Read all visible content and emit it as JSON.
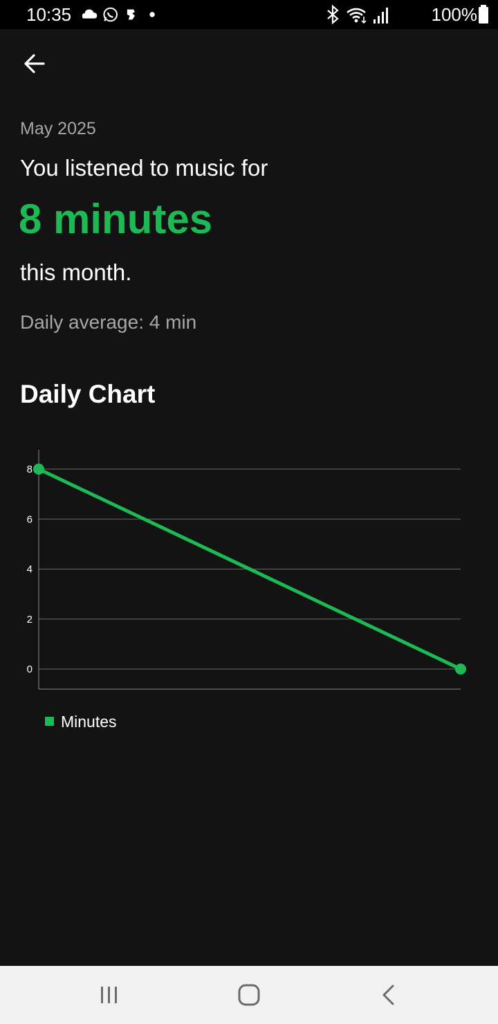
{
  "status_bar": {
    "time": "10:35",
    "battery": "100%",
    "left_icons": [
      "cloud-icon",
      "whatsapp-icon",
      "app-notification-icon",
      "dot-icon"
    ],
    "right_icons": [
      "bluetooth-icon",
      "wifi-icon",
      "signal-icon",
      "battery-icon"
    ]
  },
  "header": {
    "back_icon": "back-arrow-icon"
  },
  "summary": {
    "month": "May 2025",
    "intro": "You listened to music for",
    "total": "8 minutes",
    "suffix": "this month.",
    "daily_average": "Daily average: 4 min"
  },
  "chart_section": {
    "title": "Daily Chart"
  },
  "chart_data": {
    "type": "line",
    "x": [
      1,
      2
    ],
    "series": [
      {
        "name": "Minutes",
        "values": [
          8,
          0
        ],
        "color": "#1db954"
      }
    ],
    "yticks": [
      "0",
      "2",
      "4",
      "6",
      "8"
    ],
    "ylim": [
      0,
      8
    ],
    "grid": true,
    "legend": "bottom-left"
  },
  "nav_bar": {
    "recents_icon": "recents-icon",
    "home_icon": "home-icon",
    "back_icon": "back-icon"
  },
  "colors": {
    "accent": "#1db954",
    "background": "#131313",
    "secondary_text": "#a7a7a7"
  }
}
